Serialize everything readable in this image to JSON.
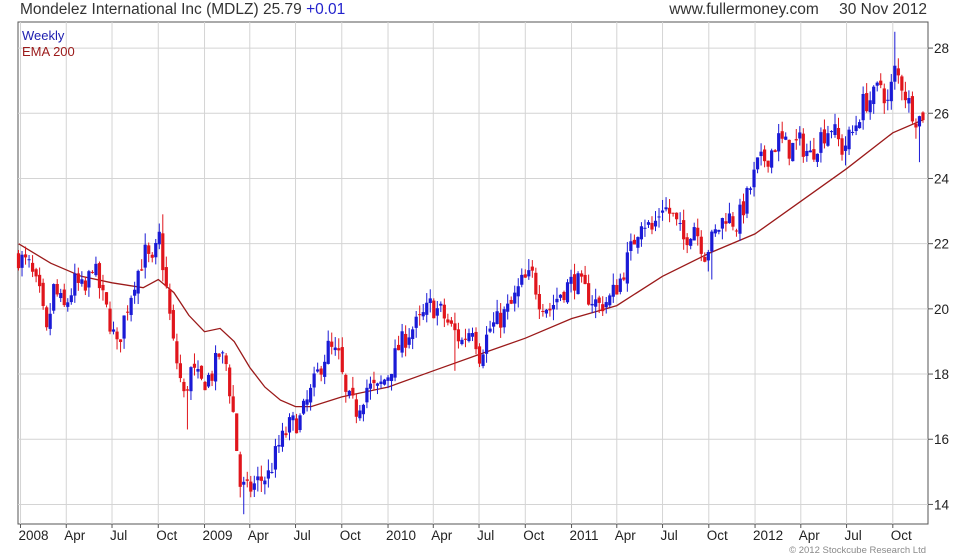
{
  "header": {
    "security": "Mondelez International Inc (MDLZ)",
    "last": "25.79",
    "change": "+0.01",
    "site": "www.fullermoney.com",
    "date": "30 Nov 2012"
  },
  "copyright": "© 2012 Stockcube Research Ltd",
  "colors": {
    "up": "#1a1ad6",
    "down": "#e0151c",
    "ema": "#9b1a1a",
    "grid": "#d4d4d4"
  },
  "chart_data": {
    "type": "candlestick",
    "frequency": "Weekly",
    "legend": [
      {
        "name": "Weekly",
        "color": "#2020b0"
      },
      {
        "name": "EMA 200",
        "color": "#9b1a1a"
      }
    ],
    "legend_position": "top-left",
    "grid": true,
    "ylim": [
      13.4,
      28.8
    ],
    "y_axis_side": "right",
    "y_ticks": [
      14,
      16,
      18,
      20,
      22,
      24,
      26,
      28
    ],
    "x_ticks": [
      {
        "label": "2008",
        "date": "2008-01-01"
      },
      {
        "label": "Apr",
        "date": "2008-04-01"
      },
      {
        "label": "Jul",
        "date": "2008-07-01"
      },
      {
        "label": "Oct",
        "date": "2008-10-01"
      },
      {
        "label": "2009",
        "date": "2009-01-01"
      },
      {
        "label": "Apr",
        "date": "2009-04-01"
      },
      {
        "label": "Jul",
        "date": "2009-07-01"
      },
      {
        "label": "Oct",
        "date": "2009-10-01"
      },
      {
        "label": "2010",
        "date": "2010-01-01"
      },
      {
        "label": "Apr",
        "date": "2010-04-01"
      },
      {
        "label": "Jul",
        "date": "2010-07-01"
      },
      {
        "label": "Oct",
        "date": "2010-10-01"
      },
      {
        "label": "2011",
        "date": "2011-01-01"
      },
      {
        "label": "Apr",
        "date": "2011-04-01"
      },
      {
        "label": "Jul",
        "date": "2011-07-01"
      },
      {
        "label": "Oct",
        "date": "2011-10-01"
      },
      {
        "label": "2012",
        "date": "2012-01-01"
      },
      {
        "label": "Apr",
        "date": "2012-04-01"
      },
      {
        "label": "Jul",
        "date": "2012-07-01"
      },
      {
        "label": "Oct",
        "date": "2012-10-01"
      }
    ],
    "xlim": [
      "2007-12-27",
      "2012-12-10"
    ],
    "price_path": [
      [
        "2007-12-28",
        21.6
      ],
      [
        "2008-01-18",
        21.3
      ],
      [
        "2008-02-08",
        20.4
      ],
      [
        "2008-02-22",
        19.2
      ],
      [
        "2008-03-07",
        20.6
      ],
      [
        "2008-03-28",
        20.0
      ],
      [
        "2008-04-18",
        20.8
      ],
      [
        "2008-05-09",
        20.5
      ],
      [
        "2008-05-23",
        21.4
      ],
      [
        "2008-06-13",
        20.3
      ],
      [
        "2008-06-27",
        19.6
      ],
      [
        "2008-07-11",
        18.8
      ],
      [
        "2008-07-25",
        19.7
      ],
      [
        "2008-08-15",
        20.9
      ],
      [
        "2008-09-05",
        21.7
      ],
      [
        "2008-09-19",
        21.3
      ],
      [
        "2008-10-03",
        22.2
      ],
      [
        "2008-10-17",
        20.6
      ],
      [
        "2008-10-31",
        18.9
      ],
      [
        "2008-11-21",
        17.3
      ],
      [
        "2008-12-05",
        18.1
      ],
      [
        "2008-12-26",
        17.7
      ],
      [
        "2009-01-16",
        18.0
      ],
      [
        "2009-01-30",
        18.6
      ],
      [
        "2009-02-13",
        18.3
      ],
      [
        "2009-02-27",
        16.8
      ],
      [
        "2009-03-13",
        14.6
      ],
      [
        "2009-03-27",
        14.4
      ],
      [
        "2009-04-17",
        14.7
      ],
      [
        "2009-05-08",
        14.9
      ],
      [
        "2009-05-29",
        15.8
      ],
      [
        "2009-06-19",
        16.4
      ],
      [
        "2009-07-10",
        16.6
      ],
      [
        "2009-07-31",
        17.4
      ],
      [
        "2009-08-21",
        18.3
      ],
      [
        "2009-09-04",
        18.8
      ],
      [
        "2009-09-25",
        18.5
      ],
      [
        "2009-10-09",
        17.3
      ],
      [
        "2009-10-30",
        16.9
      ],
      [
        "2009-11-20",
        17.6
      ],
      [
        "2009-12-11",
        17.5
      ],
      [
        "2010-01-01",
        18.0
      ],
      [
        "2010-01-22",
        18.8
      ],
      [
        "2010-02-12",
        19.3
      ],
      [
        "2010-03-05",
        19.6
      ],
      [
        "2010-03-26",
        20.1
      ],
      [
        "2010-04-16",
        19.9
      ],
      [
        "2010-05-07",
        19.4
      ],
      [
        "2010-05-28",
        19.0
      ],
      [
        "2010-06-18",
        19.5
      ],
      [
        "2010-07-02",
        18.6
      ],
      [
        "2010-07-23",
        19.4
      ],
      [
        "2010-08-13",
        19.7
      ],
      [
        "2010-09-03",
        20.1
      ],
      [
        "2010-09-24",
        20.8
      ],
      [
        "2010-10-15",
        21.0
      ],
      [
        "2010-10-29",
        20.3
      ],
      [
        "2010-11-19",
        20.0
      ],
      [
        "2010-12-10",
        20.5
      ],
      [
        "2011-01-07",
        20.9
      ],
      [
        "2011-02-04",
        20.4
      ],
      [
        "2011-02-25",
        20.1
      ],
      [
        "2011-03-18",
        20.3
      ],
      [
        "2011-04-08",
        20.9
      ],
      [
        "2011-04-29",
        21.8
      ],
      [
        "2011-05-20",
        22.8
      ],
      [
        "2011-06-10",
        22.4
      ],
      [
        "2011-07-01",
        23.2
      ],
      [
        "2011-07-22",
        22.8
      ],
      [
        "2011-08-12",
        22.1
      ],
      [
        "2011-09-02",
        22.6
      ],
      [
        "2011-09-23",
        21.7
      ],
      [
        "2011-10-14",
        22.3
      ],
      [
        "2011-11-04",
        22.9
      ],
      [
        "2011-11-25",
        22.6
      ],
      [
        "2011-12-16",
        23.4
      ],
      [
        "2012-01-06",
        24.4
      ],
      [
        "2012-01-27",
        24.7
      ],
      [
        "2012-02-17",
        25.2
      ],
      [
        "2012-03-09",
        24.9
      ],
      [
        "2012-03-30",
        25.1
      ],
      [
        "2012-04-20",
        24.7
      ],
      [
        "2012-05-11",
        25.3
      ],
      [
        "2012-06-01",
        25.6
      ],
      [
        "2012-06-22",
        24.9
      ],
      [
        "2012-07-13",
        25.4
      ],
      [
        "2012-08-03",
        26.3
      ],
      [
        "2012-08-24",
        26.5
      ],
      [
        "2012-09-07",
        26.9
      ],
      [
        "2012-09-21",
        26.3
      ],
      [
        "2012-10-05",
        27.3
      ],
      [
        "2012-10-19",
        26.9
      ],
      [
        "2012-11-02",
        26.3
      ],
      [
        "2012-11-16",
        25.9
      ],
      [
        "2012-11-30",
        25.79
      ]
    ],
    "spikes": [
      {
        "date": "2008-10-10",
        "high": 22.9
      },
      {
        "date": "2008-11-28",
        "low": 16.3
      },
      {
        "date": "2009-03-20",
        "low": 13.7
      },
      {
        "date": "2010-05-14",
        "low": 18.1
      },
      {
        "date": "2011-10-07",
        "low": 20.9
      },
      {
        "date": "2012-06-29",
        "low": 24.4
      },
      {
        "date": "2012-10-05",
        "high": 28.5
      },
      {
        "date": "2012-11-23",
        "low": 24.5
      }
    ],
    "ema_200": [
      [
        "2007-12-28",
        22.0
      ],
      [
        "2008-03-01",
        21.4
      ],
      [
        "2008-05-01",
        21.0
      ],
      [
        "2008-07-01",
        20.8
      ],
      [
        "2008-09-01",
        20.65
      ],
      [
        "2008-10-01",
        20.9
      ],
      [
        "2008-11-01",
        20.5
      ],
      [
        "2008-12-01",
        19.8
      ],
      [
        "2009-01-01",
        19.3
      ],
      [
        "2009-02-01",
        19.4
      ],
      [
        "2009-03-01",
        19.0
      ],
      [
        "2009-04-01",
        18.2
      ],
      [
        "2009-05-01",
        17.6
      ],
      [
        "2009-06-01",
        17.2
      ],
      [
        "2009-07-01",
        17.0
      ],
      [
        "2009-08-01",
        17.0
      ],
      [
        "2009-10-01",
        17.3
      ],
      [
        "2010-01-01",
        17.6
      ],
      [
        "2010-04-01",
        18.1
      ],
      [
        "2010-07-01",
        18.6
      ],
      [
        "2010-10-01",
        19.1
      ],
      [
        "2011-01-01",
        19.7
      ],
      [
        "2011-04-01",
        20.1
      ],
      [
        "2011-07-01",
        21.0
      ],
      [
        "2011-10-01",
        21.7
      ],
      [
        "2012-01-01",
        22.3
      ],
      [
        "2012-04-01",
        23.3
      ],
      [
        "2012-07-01",
        24.3
      ],
      [
        "2012-10-01",
        25.4
      ],
      [
        "2012-11-30",
        25.8
      ]
    ]
  }
}
